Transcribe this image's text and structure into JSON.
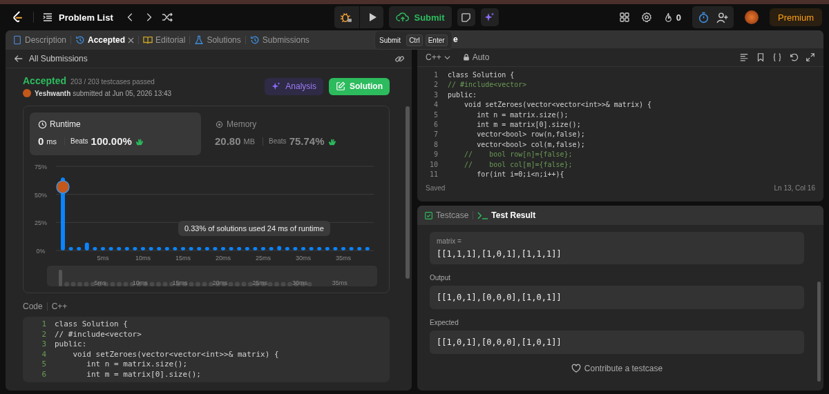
{
  "topbar": {
    "title": "Problem List",
    "submit": "Submit",
    "streak": "0",
    "timer": {
      "on": true
    },
    "premium": "Premium"
  },
  "tooltip": {
    "label": "Submit",
    "keys": [
      "Ctrl",
      "Enter"
    ]
  },
  "tabs": [
    {
      "label": "Description",
      "selected": false,
      "closable": false
    },
    {
      "label": "Accepted",
      "selected": true,
      "closable": true
    },
    {
      "label": "Editorial",
      "selected": false,
      "closable": false
    },
    {
      "label": "Solutions",
      "selected": false,
      "closable": false
    },
    {
      "label": "Submissions",
      "selected": false,
      "closable": false
    }
  ],
  "submission": {
    "back_label": "All Submissions",
    "status": "Accepted",
    "passed": "203 / 203 testcases passed",
    "user": "Yeshwanth",
    "submitted": "submitted at Jun 05, 2026 13:43",
    "buttons": [
      "Analysis",
      "Solution"
    ],
    "metrics": [
      {
        "label": "Runtime",
        "value": "0",
        "unit": "ms",
        "beats_label": "Beats",
        "beats": "100.00%",
        "selected": true
      },
      {
        "label": "Memory",
        "value": "20.80",
        "unit": "MB",
        "beats_label": "Beats",
        "beats": "75.74%",
        "selected": false
      }
    ],
    "chart_data": {
      "type": "bar",
      "x": [
        0,
        1,
        2,
        3,
        4,
        5,
        6,
        7,
        8,
        9,
        10,
        11,
        12,
        13,
        14,
        15,
        16,
        17,
        18,
        19,
        20,
        21,
        22,
        23,
        24,
        25,
        26,
        27,
        28,
        29,
        30,
        31,
        32,
        33,
        34,
        35,
        36,
        37,
        38
      ],
      "values": [
        65,
        3,
        3,
        7,
        3,
        3,
        3,
        3,
        3,
        3,
        3,
        3,
        3,
        3,
        3,
        3,
        3,
        3,
        3,
        3,
        3,
        3,
        3,
        3,
        3,
        3,
        3,
        4,
        3,
        3,
        3,
        3,
        3,
        3,
        3,
        3,
        3,
        3,
        3
      ],
      "xlim": [
        0,
        38
      ],
      "ylim": [
        0,
        75
      ],
      "yticks": [
        {
          "value": 0,
          "label": "0%"
        },
        {
          "value": 25,
          "label": "25%"
        },
        {
          "value": 50,
          "label": "50%"
        },
        {
          "value": 75,
          "label": "75%"
        }
      ],
      "xticks": [
        {
          "value": 5,
          "label": "5ms"
        },
        {
          "value": 10,
          "label": "10ms"
        },
        {
          "value": 15,
          "label": "15ms"
        },
        {
          "value": 20,
          "label": "20ms"
        },
        {
          "value": 25,
          "label": "25ms"
        },
        {
          "value": 30,
          "label": "30ms"
        },
        {
          "value": 35,
          "label": "35ms"
        }
      ],
      "annotations": [
        "0.33% of solutions used 24 ms of runtime"
      ]
    },
    "overview_labels": [
      "5ms",
      "10ms",
      "15ms",
      "20ms",
      "25ms",
      "30ms",
      "35ms"
    ],
    "code_label": "Code",
    "code_lang": "C++",
    "code": [
      {
        "no": "1",
        "text": "class Solution {"
      },
      {
        "no": "2",
        "text": "// #include<vector>"
      },
      {
        "no": "3",
        "text": "public:"
      },
      {
        "no": "4",
        "text": "    void setZeroes(vector<vector<int>>& matrix) {"
      },
      {
        "no": "5",
        "text": "       int n = matrix.size();"
      },
      {
        "no": "6",
        "text": "       int m = matrix[0].size();"
      }
    ]
  },
  "editor": {
    "title": "e",
    "language": "C++",
    "mode": "Auto",
    "lines": [
      {
        "no": "1",
        "text": "class Solution {",
        "kind": "code"
      },
      {
        "no": "2",
        "text": "// #include<vector>",
        "kind": "comment"
      },
      {
        "no": "3",
        "text": "public:",
        "kind": "code"
      },
      {
        "no": "4",
        "text": "    void setZeroes(vector<vector<int>>& matrix) {",
        "kind": "code"
      },
      {
        "no": "5",
        "text": "       int n = matrix.size();",
        "kind": "code"
      },
      {
        "no": "6",
        "text": "       int m = matrix[0].size();",
        "kind": "code"
      },
      {
        "no": "7",
        "text": "       vector<bool> row(n,false);",
        "kind": "code"
      },
      {
        "no": "8",
        "text": "       vector<bool> col(m,false);",
        "kind": "code"
      },
      {
        "no": "9",
        "text": "    //    bool row[n]={false};",
        "kind": "comment"
      },
      {
        "no": "10",
        "text": "    //    bool col[m]={false};",
        "kind": "comment"
      },
      {
        "no": "11",
        "text": "       for(int i=0;i<n;i++){",
        "kind": "code"
      }
    ],
    "status": "Saved",
    "cursor": "Ln 13, Col 16"
  },
  "test_tabs": [
    {
      "label": "Testcase",
      "selected": false
    },
    {
      "label": "Test Result",
      "selected": true
    }
  ],
  "test_input": {
    "var": "matrix =",
    "value": "[[1,1,1],[1,0,1],[1,1,1]]"
  },
  "test_sections": [
    {
      "label": "Output",
      "value": "[[1,0,1],[0,0,0],[1,0,1]]"
    },
    {
      "label": "Expected",
      "value": "[[1,0,1],[0,0,0],[1,0,1]]"
    }
  ],
  "contribute": "Contribute a testcase"
}
